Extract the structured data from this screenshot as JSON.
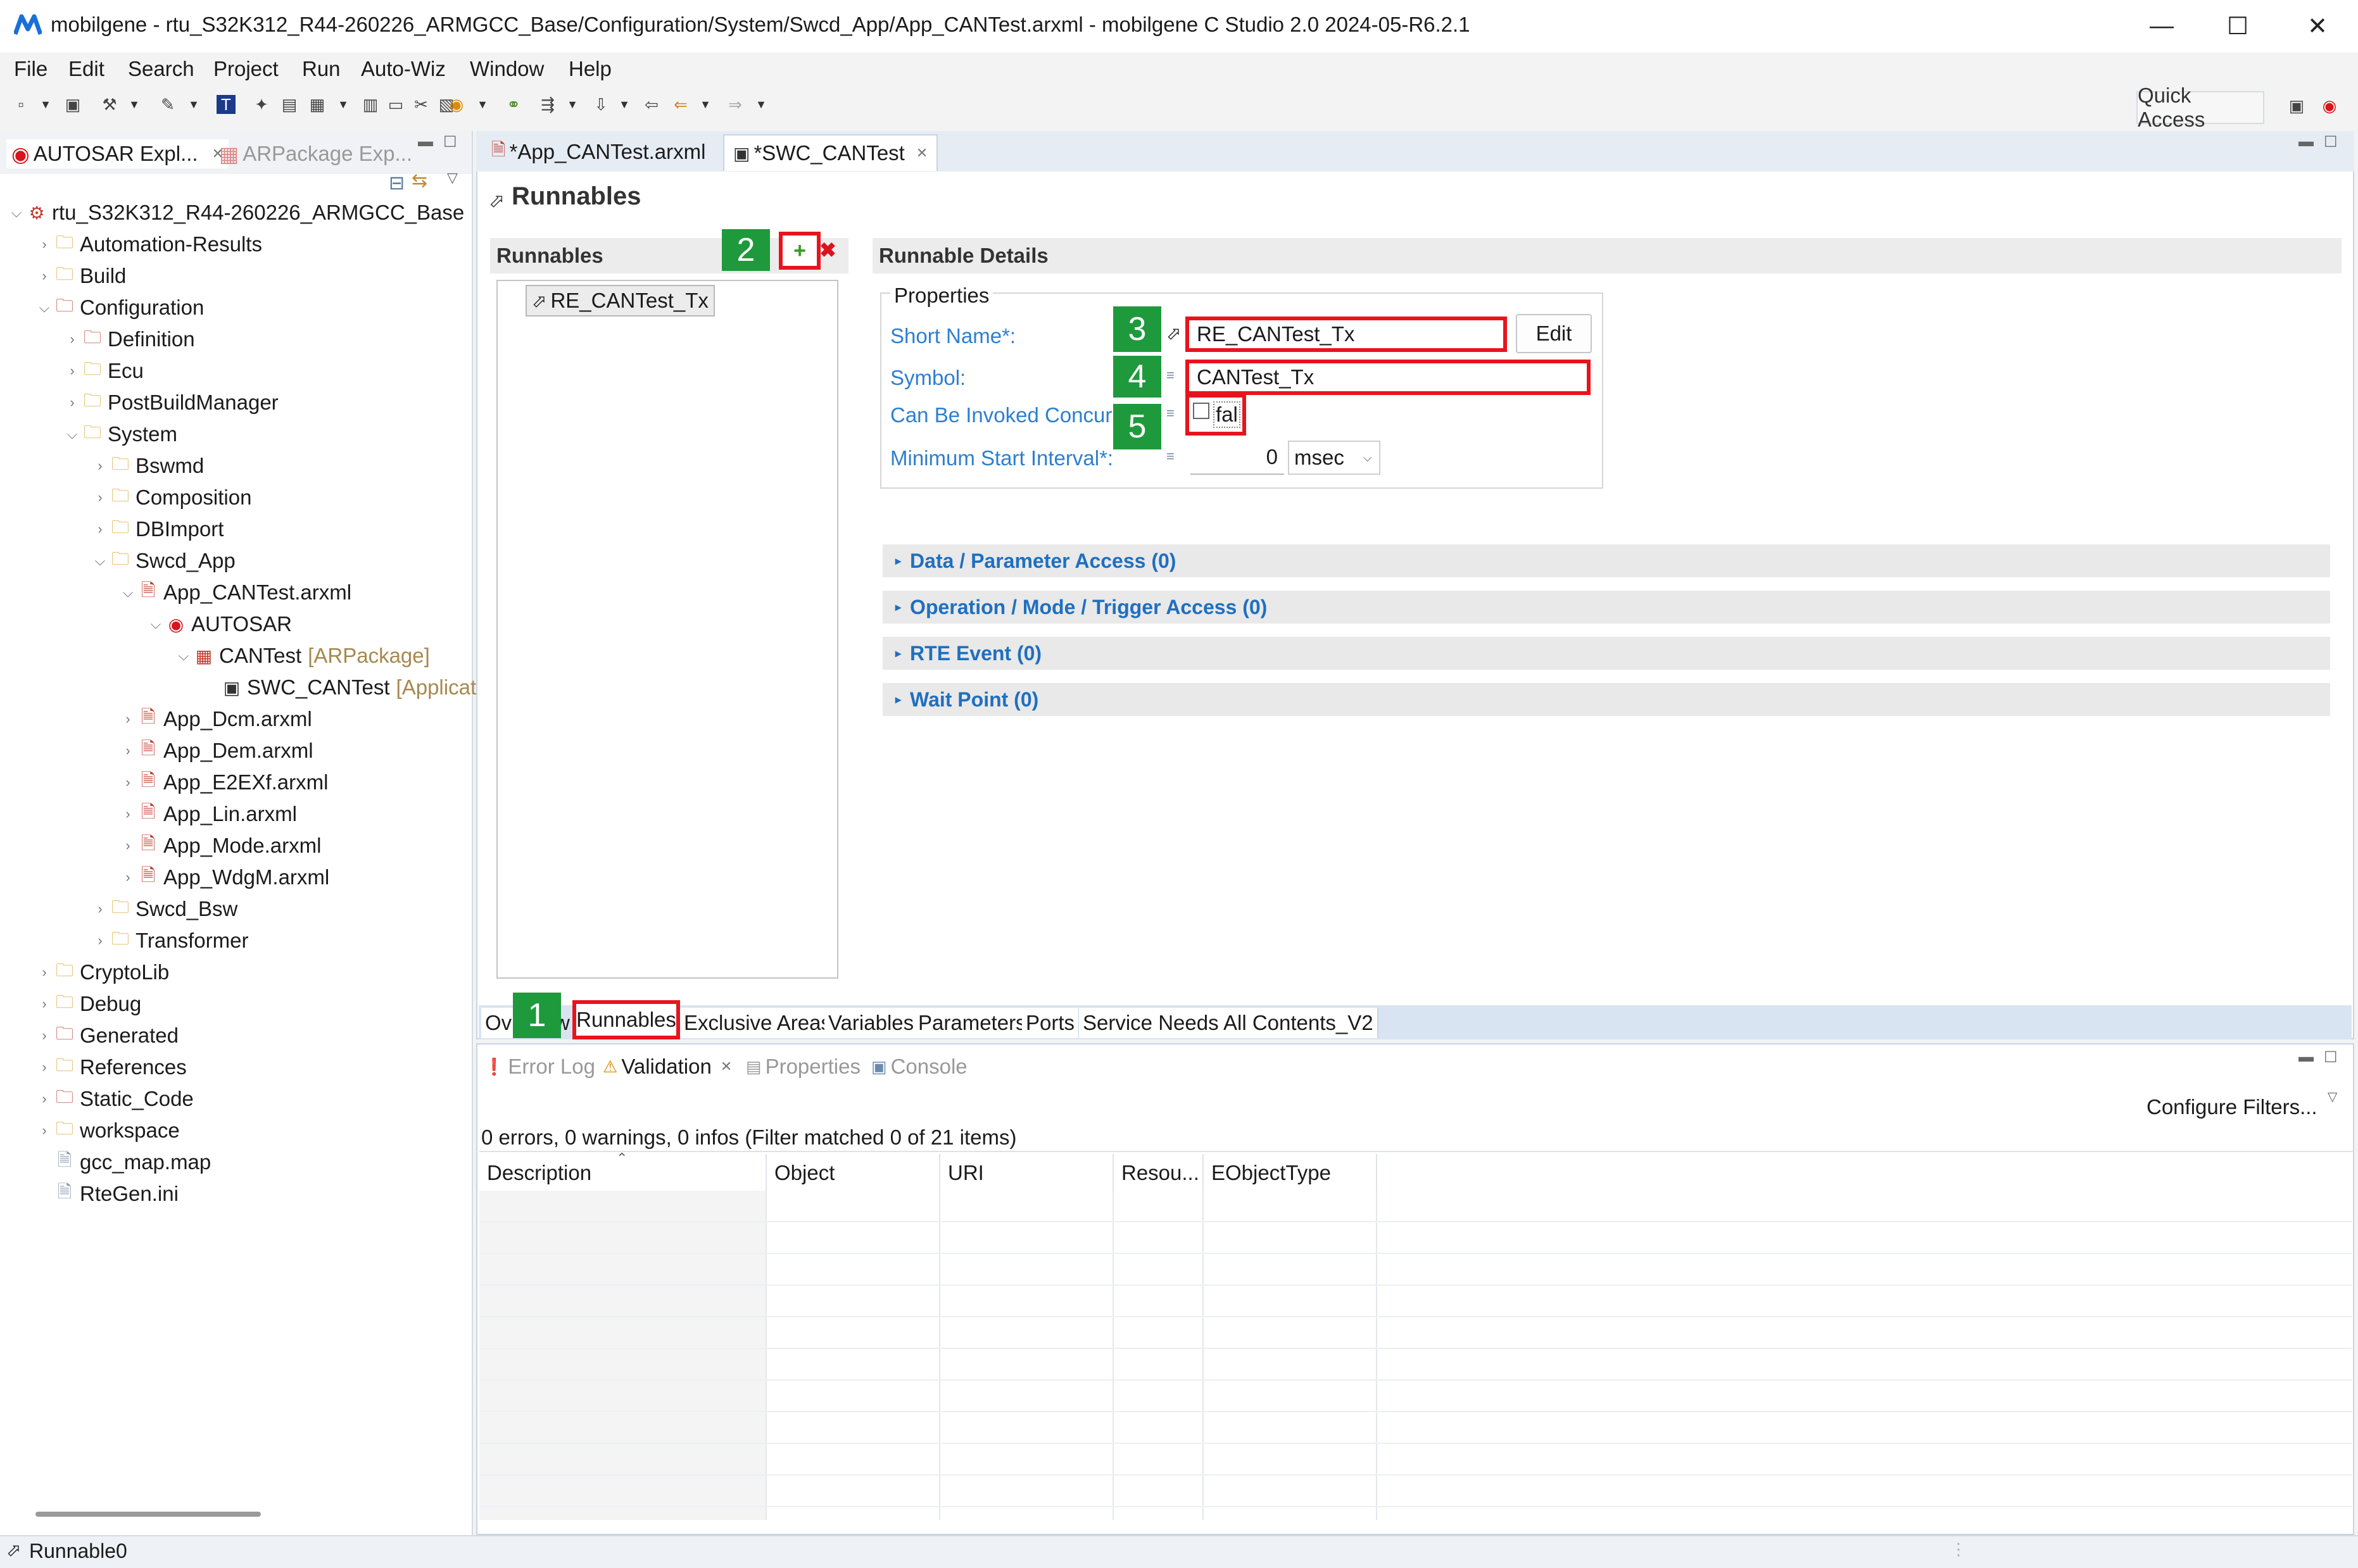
{
  "window": {
    "title": "mobilgene - rtu_S32K312_R44-260226_ARMGCC_Base/Configuration/System/Swcd_App/App_CANTest.arxml - mobilgene C Studio 2.0 2024-05-R6.2.1",
    "minimize": "—",
    "maximize": "☐",
    "close": "✕"
  },
  "menu": [
    "File",
    "Edit",
    "Search",
    "Project",
    "Run",
    "Auto-Wiz",
    "Window",
    "Help"
  ],
  "toolbar": {
    "quick_access": "Quick Access"
  },
  "left": {
    "tabs": [
      "AUTOSAR Expl...",
      "ARPackage Exp..."
    ],
    "tree": [
      {
        "label": "rtu_S32K312_R44-260226_ARMGCC_Base",
        "suffix": ""
      },
      {
        "label": "Automation-Results",
        "suffix": ""
      },
      {
        "label": "Build",
        "suffix": ""
      },
      {
        "label": "Configuration",
        "suffix": ""
      },
      {
        "label": "Definition",
        "suffix": ""
      },
      {
        "label": "Ecu",
        "suffix": ""
      },
      {
        "label": "PostBuildManager",
        "suffix": ""
      },
      {
        "label": "System",
        "suffix": ""
      },
      {
        "label": "Bswmd",
        "suffix": ""
      },
      {
        "label": "Composition",
        "suffix": ""
      },
      {
        "label": "DBImport",
        "suffix": ""
      },
      {
        "label": "Swcd_App",
        "suffix": ""
      },
      {
        "label": "App_CANTest.arxml",
        "suffix": ""
      },
      {
        "label": "AUTOSAR",
        "suffix": ""
      },
      {
        "label": "CANTest",
        "suffix": "[ARPackage]"
      },
      {
        "label": "SWC_CANTest",
        "suffix": "[Applicat"
      },
      {
        "label": "App_Dcm.arxml",
        "suffix": ""
      },
      {
        "label": "App_Dem.arxml",
        "suffix": ""
      },
      {
        "label": "App_E2EXf.arxml",
        "suffix": ""
      },
      {
        "label": "App_Lin.arxml",
        "suffix": ""
      },
      {
        "label": "App_Mode.arxml",
        "suffix": ""
      },
      {
        "label": "App_WdgM.arxml",
        "suffix": ""
      },
      {
        "label": "Swcd_Bsw",
        "suffix": ""
      },
      {
        "label": "Transformer",
        "suffix": ""
      },
      {
        "label": "CryptoLib",
        "suffix": ""
      },
      {
        "label": "Debug",
        "suffix": ""
      },
      {
        "label": "Generated",
        "suffix": ""
      },
      {
        "label": "References",
        "suffix": ""
      },
      {
        "label": "Static_Code",
        "suffix": ""
      },
      {
        "label": "workspace",
        "suffix": ""
      },
      {
        "label": "gcc_map.map",
        "suffix": ""
      },
      {
        "label": "RteGen.ini",
        "suffix": ""
      }
    ]
  },
  "editor": {
    "tabs": [
      "*App_CANTest.arxml",
      "*SWC_CANTest"
    ],
    "page_title": "Runnables",
    "runnables_header": "Runnables",
    "runnable_item": "RE_CANTest_Tx",
    "details_header": "Runnable Details",
    "properties_label": "Properties",
    "short_name_label": "Short Name*:",
    "short_name_value": "RE_CANTest_Tx",
    "edit_button": "Edit",
    "symbol_label": "Symbol:",
    "symbol_value": "CANTest_Tx",
    "concurrent_label": "Can Be Invoked Concurr",
    "concurrent_value": "fal",
    "min_interval_label": "Minimum Start Interval*:",
    "min_interval_value": "0",
    "min_interval_unit": "msec",
    "sections": [
      "Data / Parameter Access (0)",
      "Operation / Mode / Trigger Access (0)",
      "RTE Event (0)",
      "Wait Point (0)"
    ],
    "bottom_tabs": [
      "Ov",
      "w",
      "Runnables",
      "Exclusive Areas",
      "Variables",
      "Parameters",
      "Ports",
      "Service Needs",
      "All Contents_V2"
    ]
  },
  "badges": [
    "1",
    "2",
    "3",
    "4",
    "5"
  ],
  "bottom": {
    "tabs": [
      "Error Log",
      "Validation",
      "Properties",
      "Console"
    ],
    "configure_filters": "Configure Filters...",
    "summary": "0 errors, 0 warnings, 0 infos (Filter matched 0 of 21 items)",
    "columns": [
      "Description",
      "Object",
      "URI",
      "Resou...",
      "EObjectType"
    ]
  },
  "status": {
    "text": "Runnable0"
  },
  "colors": {
    "accent_red": "#e8141c",
    "badge_green": "#1e9a3c",
    "link_blue": "#2d7fd0"
  }
}
